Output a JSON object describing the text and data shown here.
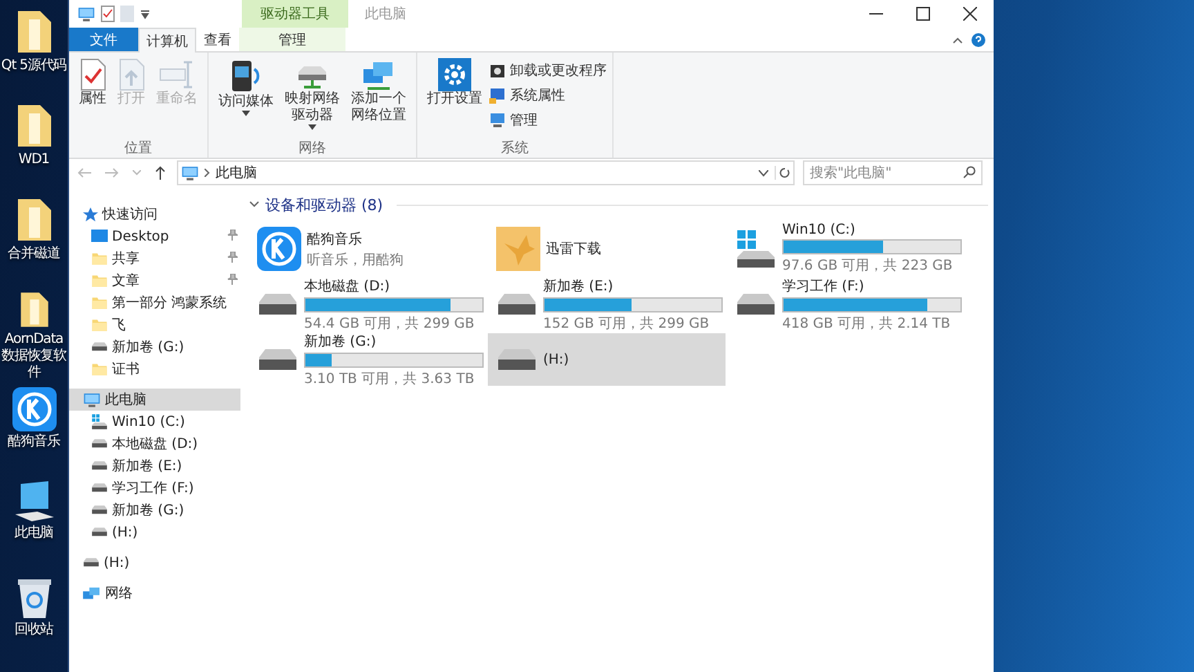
{
  "desktop_icons": [
    {
      "label": "Qt 5源代码",
      "kind": "folder"
    },
    {
      "label": "WD1",
      "kind": "folder"
    },
    {
      "label": "合并磁道",
      "kind": "folder"
    },
    {
      "label": "AornData数据恢复软件",
      "kind": "folder"
    },
    {
      "label": "酷狗音乐",
      "kind": "app"
    },
    {
      "label": "此电脑",
      "kind": "pc"
    },
    {
      "label": "回收站",
      "kind": "bin"
    }
  ],
  "window": {
    "title": "此电脑",
    "context_group": "驱动器工具"
  },
  "tabs": [
    {
      "label": "文件",
      "kind": "file",
      "selected": false
    },
    {
      "label": "计算机",
      "kind": "normal",
      "selected": true
    },
    {
      "label": "查看",
      "kind": "normal",
      "selected": false
    },
    {
      "label": "管理",
      "kind": "context",
      "selected": false
    }
  ],
  "ribbon_groups": [
    {
      "label": "位置",
      "buttons": [
        {
          "label": "属性",
          "kind": "props",
          "disabled": false,
          "dropdown": false
        },
        {
          "label": "打开",
          "kind": "open",
          "disabled": true,
          "dropdown": false
        },
        {
          "label": "重命名",
          "kind": "rename",
          "disabled": true,
          "dropdown": false
        }
      ]
    },
    {
      "label": "网络",
      "buttons": [
        {
          "label": "访问媒体",
          "kind": "media",
          "disabled": false,
          "dropdown": true
        },
        {
          "label": "映射网络驱动器",
          "kind": "map",
          "disabled": false,
          "dropdown": true
        },
        {
          "label": "添加一个网络位置",
          "kind": "netloc",
          "disabled": false,
          "dropdown": false
        }
      ]
    },
    {
      "label": "系统",
      "buttons": [
        {
          "label": "打开设置",
          "kind": "settings",
          "disabled": false,
          "dropdown": false
        }
      ],
      "small_buttons": [
        {
          "label": "卸载或更改程序",
          "kind": "uninstall"
        },
        {
          "label": "系统属性",
          "kind": "sysprops"
        },
        {
          "label": "管理",
          "kind": "manage"
        }
      ]
    }
  ],
  "address_bar": {
    "path": "此电脑"
  },
  "search": {
    "placeholder": "搜索\"此电脑\""
  },
  "nav": [
    {
      "label": "快速访问",
      "kind": "star",
      "selected": false,
      "children": [
        {
          "label": "Desktop",
          "kind": "desktop",
          "pinned": true,
          "selected": false
        },
        {
          "label": "共享",
          "kind": "folder",
          "pinned": true,
          "selected": false
        },
        {
          "label": "文章",
          "kind": "folder",
          "pinned": true,
          "selected": false
        },
        {
          "label": "第一部分 鸿蒙系统",
          "kind": "folder",
          "pinned": false,
          "selected": false
        },
        {
          "label": "飞",
          "kind": "folder",
          "pinned": false,
          "selected": false
        },
        {
          "label": "新加卷 (G:)",
          "kind": "drive",
          "pinned": false,
          "selected": false
        },
        {
          "label": "证书",
          "kind": "folder",
          "pinned": false,
          "selected": false
        }
      ]
    },
    {
      "label": "此电脑",
      "kind": "pc",
      "selected": true,
      "children": [
        {
          "label": "Win10 (C:)",
          "kind": "windrive",
          "pinned": false,
          "selected": false
        },
        {
          "label": "本地磁盘 (D:)",
          "kind": "drive",
          "pinned": false,
          "selected": false
        },
        {
          "label": "新加卷 (E:)",
          "kind": "drive",
          "pinned": false,
          "selected": false
        },
        {
          "label": "学习工作 (F:)",
          "kind": "drive",
          "pinned": false,
          "selected": false
        },
        {
          "label": "新加卷 (G:)",
          "kind": "drive",
          "pinned": false,
          "selected": false
        },
        {
          "label": " (H:)",
          "kind": "drive",
          "pinned": false,
          "selected": false
        }
      ]
    },
    {
      "label": "(H:)",
      "kind": "drive",
      "selected": false
    },
    {
      "label": "网络",
      "kind": "network",
      "selected": false
    }
  ],
  "group": {
    "title": "设备和驱动器 (8)",
    "expanded": true,
    "items": [
      {
        "kind": "app",
        "name": "酷狗音乐",
        "subtitle": "听音乐，用酷狗",
        "selected": false
      },
      {
        "kind": "app",
        "name": "迅雷下载",
        "selected": false
      },
      {
        "kind": "drive",
        "name": "Win10 (C:)",
        "level": 0.56,
        "info": "97.6 GB 可用，共 223 GB",
        "selected": false
      },
      {
        "kind": "drive",
        "name": "本地磁盘 (D:)",
        "level": 0.82,
        "info": "54.4 GB 可用，共 299 GB",
        "selected": false
      },
      {
        "kind": "drive",
        "name": "新加卷 (E:)",
        "level": 0.49,
        "info": "152 GB 可用，共 299 GB",
        "selected": false
      },
      {
        "kind": "drive",
        "name": "学习工作 (F:)",
        "level": 0.81,
        "info": "418 GB 可用，共 2.14 TB",
        "selected": false
      },
      {
        "kind": "drive",
        "name": "新加卷 (G:)",
        "level": 0.15,
        "info": "3.10 TB 可用，共 3.63 TB",
        "selected": false
      },
      {
        "kind": "plain",
        "name": "(H:)",
        "selected": true
      }
    ]
  }
}
